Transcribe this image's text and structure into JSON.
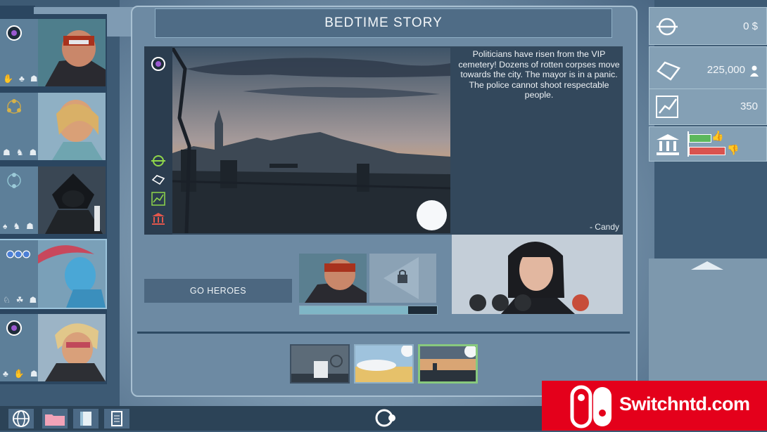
{
  "title": "BEDTIME STORY",
  "story": {
    "text": "Politicians have risen from the VIP cemetery! Dozens of rotten corpses move towards the city. The mayor is in a panic. The police cannot shoot respectable people.",
    "signature": "- Candy"
  },
  "actions": {
    "go_heroes_label": "GO HEROES"
  },
  "mission": {
    "progress": 0.79
  },
  "resources": {
    "money": "0 $",
    "population": "225,000",
    "growth": "350"
  },
  "colors": {
    "accent": "#7fb6c6",
    "panel": "#6d8aa3",
    "title_bar": "#4f6c86",
    "approval_green": "#5cb85c",
    "approval_red": "#d9534f"
  },
  "icons": {
    "event_side": [
      "money-icon",
      "reputation-icon",
      "growth-icon",
      "city-hall-icon"
    ],
    "hero_classes": [
      "purple-ring-icon",
      "tri-dot-icon",
      "dual-dot-icon",
      "blue-dot-icon",
      "purple-ring-icon"
    ],
    "bottom_tabs": [
      "globe-icon",
      "folder-icon",
      "book-icon",
      "clipboard-icon"
    ],
    "call_controls": [
      "mute-mic-icon",
      "mute-speaker-icon",
      "camera-off-icon",
      "hang-up-icon"
    ]
  },
  "watermark": "Switchntd.com"
}
